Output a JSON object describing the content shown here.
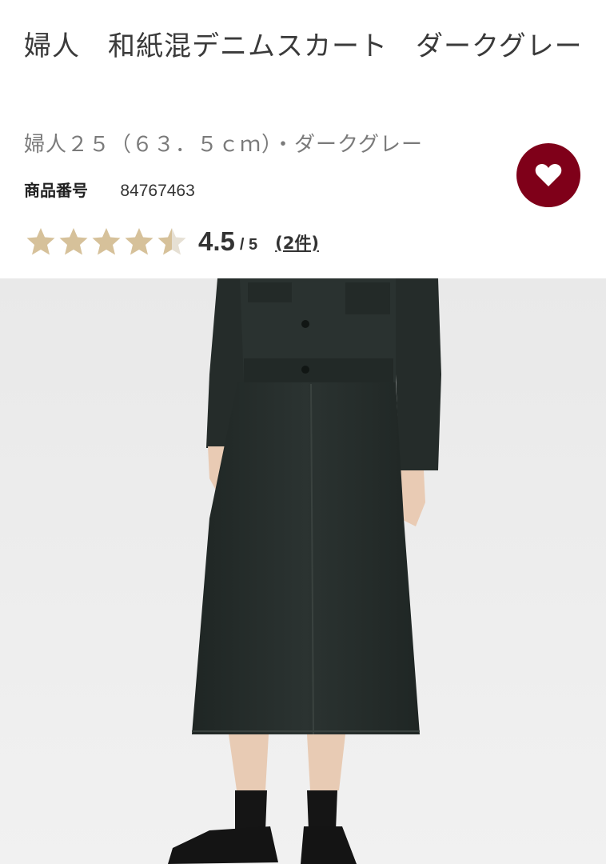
{
  "product": {
    "title": "婦人　和紙混デニムスカート　ダークグレー",
    "variant": "婦人２５（６３．５ｃｍ）・ダークグレー",
    "sku_label": "商品番号",
    "sku_value": "84767463"
  },
  "rating": {
    "score": "4.5",
    "max": "/ 5",
    "value": 4.5,
    "out_of": 5,
    "review_link": "(2件)"
  },
  "icons": {
    "favorite": "heart-icon",
    "star": "star-icon"
  },
  "colors": {
    "favorite_bg": "#7f0019",
    "star_fill": "#d6c19a",
    "star_empty": "#e6e0d4",
    "photo_bg": "#ececec",
    "garment": "#262c2a"
  }
}
